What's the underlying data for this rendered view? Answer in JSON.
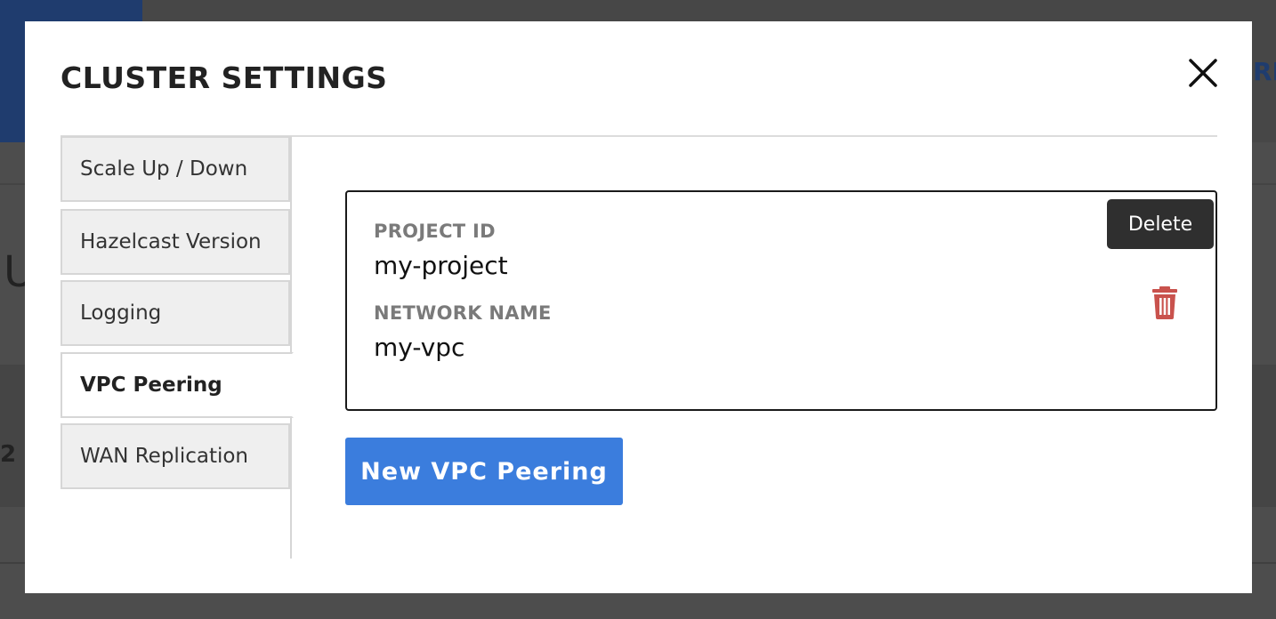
{
  "background": {
    "fragment_left": "U",
    "fragment_number": "2",
    "fragment_right": "RIS"
  },
  "modal": {
    "title": "CLUSTER SETTINGS",
    "close_icon": "close-icon"
  },
  "tabs": [
    {
      "label": "Scale Up / Down",
      "active": false
    },
    {
      "label": "Hazelcast Version",
      "active": false
    },
    {
      "label": "Logging",
      "active": false
    },
    {
      "label": "VPC Peering",
      "active": true
    },
    {
      "label": "WAN Replication",
      "active": false
    }
  ],
  "peering": {
    "project_id_label": "PROJECT ID",
    "project_id_value": "my-project",
    "network_name_label": "NETWORK NAME",
    "network_name_value": "my-vpc",
    "delete_tooltip": "Delete",
    "delete_icon": "trash-icon",
    "delete_color": "#c9524d"
  },
  "actions": {
    "new_peering_label": "New VPC Peering",
    "new_peering_color": "#3b7ddd"
  }
}
